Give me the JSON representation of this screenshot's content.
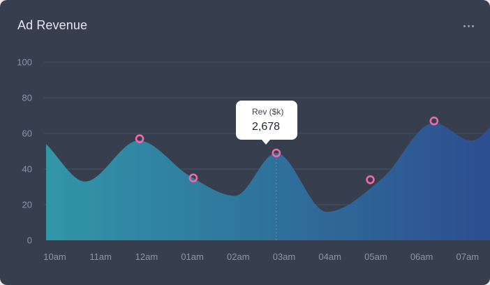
{
  "card": {
    "title": "Ad Revenue"
  },
  "chart_data": {
    "type": "area",
    "title": "Ad Revenue",
    "categories": [
      "10am",
      "11am",
      "12am",
      "01am",
      "02am",
      "03am",
      "04am",
      "05am",
      "06am",
      "07am"
    ],
    "series": [
      {
        "values": [
          {
            "x": -0.19,
            "y": 54
          },
          {
            "x": 0.66,
            "y": 33
          },
          {
            "x": 1.83,
            "y": 56
          },
          {
            "x": 2.95,
            "y": 36
          },
          {
            "x": 3.93,
            "y": 25
          },
          {
            "x": 4.83,
            "y": 49
          },
          {
            "x": 5.93,
            "y": 16
          },
          {
            "x": 7.15,
            "y": 35
          },
          {
            "x": 8.27,
            "y": 66
          },
          {
            "x": 9.08,
            "y": 56
          },
          {
            "x": 9.82,
            "y": 73
          }
        ]
      }
    ],
    "markers": [
      {
        "x": 1.85,
        "y": 57
      },
      {
        "x": 3.02,
        "y": 35
      },
      {
        "x": 4.83,
        "y": 49
      },
      {
        "x": 6.88,
        "y": 34
      },
      {
        "x": 8.27,
        "y": 67
      }
    ],
    "ylim": [
      0,
      100
    ],
    "yticks": [
      0,
      20,
      40,
      60,
      80,
      100
    ],
    "grid": true,
    "tooltip": {
      "x": 4.83,
      "label": "Rev ($k)",
      "value": "2,678"
    },
    "colors": {
      "background": "#373f4f",
      "grid": "#465063",
      "fill_start": "#3196a8",
      "fill_end": "#2d4b8e",
      "marker": "#f06aa8"
    }
  }
}
